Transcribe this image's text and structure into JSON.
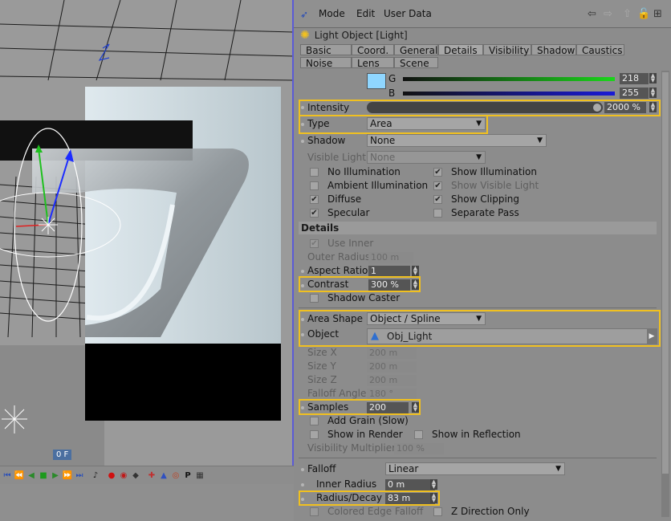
{
  "viewport": {
    "frame_label": "0 F"
  },
  "transport": {
    "buttons": [
      "go-start-icon",
      "prev-key-icon",
      "step-back-icon",
      "play-icon",
      "step-forward-icon",
      "next-key-icon",
      "go-end-icon",
      "sound-icon",
      "record-icon",
      "autokey-icon",
      "keyframe-icon",
      "move-icon",
      "rotate-icon",
      "scale-icon",
      "point-level-icon",
      "param-icon",
      "grid-icon"
    ]
  },
  "menubar": {
    "items": [
      "Mode",
      "Edit",
      "User Data"
    ]
  },
  "object": {
    "title": "Light Object [Light]"
  },
  "tabs": {
    "row1": [
      "Basic",
      "Coord.",
      "General",
      "Details",
      "Visibility",
      "Shadow",
      "Caustics"
    ],
    "row2": [
      "Noise",
      "Lens",
      "Scene"
    ],
    "active": "Details"
  },
  "color": {
    "g_label": "G",
    "g_value": "218",
    "b_label": "B",
    "b_value": "255",
    "swatch": "#8fd6ff"
  },
  "general": {
    "intensity_label": "Intensity",
    "intensity_value": "2000 %",
    "type_label": "Type",
    "type_value": "Area",
    "shadow_label": "Shadow",
    "shadow_value": "None",
    "visible_light_label": "Visible Light",
    "visible_light_value": "None",
    "checks": [
      {
        "label": "No Illumination",
        "checked": false
      },
      {
        "label": "Show Illumination",
        "checked": true
      },
      {
        "label": "Ambient Illumination",
        "checked": false
      },
      {
        "label": "Show Visible Light",
        "checked": true
      },
      {
        "label": "Diffuse",
        "checked": true
      },
      {
        "label": "Show Clipping",
        "checked": true
      },
      {
        "label": "Specular",
        "checked": true
      },
      {
        "label": "Separate Pass",
        "checked": false
      }
    ]
  },
  "details": {
    "header": "Details",
    "use_inner_label": "Use Inner",
    "outer_radius_label": "Outer Radius",
    "outer_radius_value": "100 m",
    "aspect_ratio_label": "Aspect Ratio",
    "aspect_ratio_value": "1",
    "contrast_label": "Contrast",
    "contrast_value": "300 %",
    "shadow_caster_label": "Shadow Caster",
    "area_shape_label": "Area Shape",
    "area_shape_value": "Object / Spline",
    "object_label": "Object",
    "object_value": "Obj_Light",
    "size_x_label": "Size X",
    "size_x_value": "200 m",
    "size_y_label": "Size Y",
    "size_y_value": "200 m",
    "size_z_label": "Size Z",
    "size_z_value": "200 m",
    "falloff_angle_label": "Falloff Angle",
    "falloff_angle_value": "180 °",
    "samples_label": "Samples",
    "samples_value": "200",
    "add_grain_label": "Add Grain (Slow)",
    "show_in_render_label": "Show in Render",
    "show_in_reflection_label": "Show in Reflection",
    "visibility_multiplier_label": "Visibility Multiplier",
    "visibility_multiplier_value": "100 %"
  },
  "falloff": {
    "falloff_label": "Falloff",
    "falloff_value": "Linear",
    "inner_radius_label": "Inner Radius",
    "inner_radius_value": "0 m",
    "radius_decay_label": "Radius/Decay",
    "radius_decay_value": "83 m",
    "colored_edge_label": "Colored Edge Falloff",
    "z_direction_label": "Z Direction Only"
  },
  "highlight_color": "#f0c020"
}
